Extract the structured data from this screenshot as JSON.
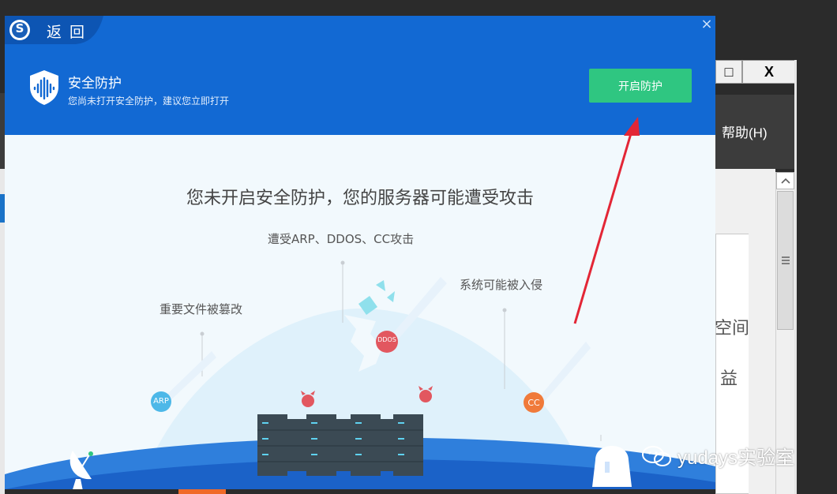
{
  "background_app": {
    "menu_help": "帮助(H)",
    "side_text_1": "空间",
    "side_text_2": "益",
    "max_glyph": "□",
    "close_glyph": "X"
  },
  "dialog": {
    "back_label": "返 回",
    "logo_letter": "S",
    "close_glyph": "×",
    "protection": {
      "title": "安全防护",
      "subtitle": "您尚未打开安全防护，建议您立即打开",
      "enable_button": "开启防护"
    },
    "scene": {
      "headline": "您未开启安全防护，您的服务器可能遭受攻击",
      "label_attack": "遭受ARP、DDOS、CC攻击",
      "label_intrusion": "系统可能被入侵",
      "label_files": "重要文件被篡改",
      "badge_arp": "ARP",
      "badge_ddos": "DDOS",
      "badge_cc": "CC"
    }
  },
  "watermark": {
    "text": "yudays实验室"
  },
  "colors": {
    "header_blue": "#1269d3",
    "button_green": "#2fc681",
    "annotation_red": "#e32636"
  }
}
